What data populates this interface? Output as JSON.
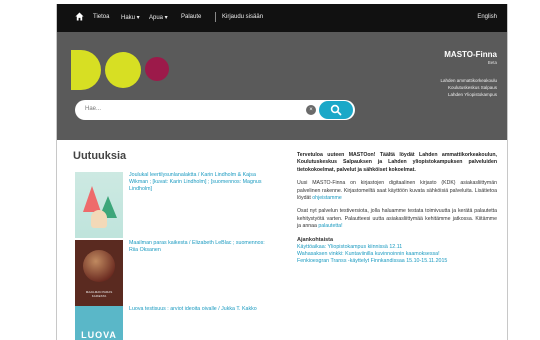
{
  "nav": {
    "items": [
      "Tietoa",
      "Haku ▾",
      "Apua ▾",
      "Palaute",
      "Kirjaudu sisään"
    ],
    "language": "English"
  },
  "header": {
    "title": "MASTO-Finna",
    "subtitle": "Beta",
    "libraries": [
      "Lahden ammattikorkeakoulu",
      "Koulutuskeskus Salpaus",
      "Lahden Yliopistokampus"
    ]
  },
  "search": {
    "placeholder": "Hae...",
    "clear_symbol": "×"
  },
  "news": {
    "title": "Uutuuksia",
    "items": [
      {
        "text": "Joulukal leertilysunlanalaktta / Karin Lindholm & Kajsa Wikman ; [kuvat: Karin Lindholm] ; [suomennos: Magnus Lindholm]",
        "cover_title": ""
      },
      {
        "text": "Maailman paras kaikesta / Elizabeth LeBlac ; suomennos: Riia Oksanen",
        "cover_title": "MAAILMAN PARAS KAIKESTA"
      },
      {
        "text": "Luova testisuus : arviot ideoita oivalle / Jukka T. Kakko",
        "cover_title": "LUOVA"
      }
    ]
  },
  "intro": {
    "paragraphs": [
      "Tervetuloa uuteen MASTOon! Täältä löydät Lahden ammattikorkeakoulun, Koulutuskeskus Salpauksen ja Lahden yliopistokampuksen palveluiden tietokokoelmat, palvelut ja sähköiset kokoelmat.",
      "Uusi MASTO-Finna on kirjastojen digitaalinen kirjasto (KDK) asiakasliittymän palvelinen rakenne. Kirjastomeiltä saat käyttöön kuvata sähköisiä palveluita. Lisätietoa löydät",
      "Osat nyt palvelun testiversiota, jolla haluamme testata toimivuutta ja kerätä palautetta kehitystyötä varten. Palautteesi uutta asiakasliittymää kehitämme jatkossa. Kiitämme ja annaa"
    ],
    "link_more": "ohjeistamme",
    "link_feedback": "palautetta!",
    "current_heading": "Ajankohtaista",
    "current_items": [
      "Käyttöaikaa: Yliopistokampus kiinnissä 12.11",
      "Wahasaksen vinkki: Kuntaviinilla kuvinnoinnin kaamoksessa!",
      "Fenkioesgran Transs -käyttelyt Finnkandissaa 15.10-15.11.2015"
    ]
  },
  "colors": {
    "topbar": "#111111",
    "header": "#5a5a5a",
    "logo_yellow": "#d7df23",
    "logo_magenta": "#9c1a4a",
    "accent": "#1ba8c8",
    "link": "#1a9ac0"
  },
  "icons": {
    "home": "home-icon",
    "search": "search-icon",
    "clear": "clear-icon"
  }
}
